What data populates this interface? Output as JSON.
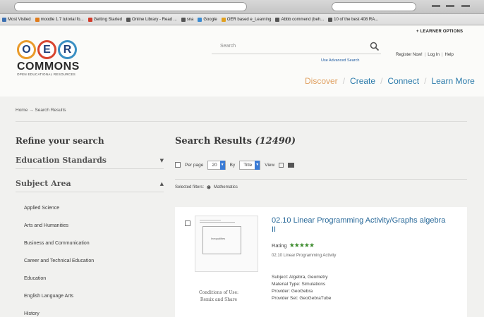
{
  "bookmarks": [
    {
      "label": "Most Visited",
      "color": "#3b6fb0"
    },
    {
      "label": "moodle 1.7 tutorial fo...",
      "color": "#e07b1a"
    },
    {
      "label": "Getting Started",
      "color": "#d13b2a"
    },
    {
      "label": "Online Library - Read ...",
      "color": "#555555"
    },
    {
      "label": "sna",
      "color": "#555555"
    },
    {
      "label": "Google",
      "color": "#3a8ad0"
    },
    {
      "label": "OER based e_Learning",
      "color": "#e0a020"
    },
    {
      "label": "Abbb commend (beh...",
      "color": "#555555"
    },
    {
      "label": "10 of the best 408 RA...",
      "color": "#555555"
    }
  ],
  "logo": {
    "letters": [
      "O",
      "E",
      "R"
    ],
    "name": "COMMONS",
    "tagline": "OPEN EDUCATIONAL RESOURCES"
  },
  "header": {
    "search_placeholder": "Search",
    "advanced_search": "Use Advanced Search",
    "learner_options": "+ LEARNER OPTIONS",
    "register": "Register Now!",
    "login": "Log In",
    "help": "Help",
    "nav": [
      "Discover",
      "Create",
      "Connect",
      "Learn More"
    ]
  },
  "breadcrumb": "Home → Search Results",
  "sidebar": {
    "title": "Refine your search",
    "facets": [
      {
        "label": "Education Standards",
        "arrow": "▼"
      },
      {
        "label": "Subject Area",
        "arrow": "▲"
      }
    ],
    "subjects": [
      "Applied Science",
      "Arts and Humanities",
      "Business and Communication",
      "Career and Technical Education",
      "Education",
      "English Language Arts",
      "History"
    ]
  },
  "results": {
    "title": "Search Results",
    "count": "(12490)",
    "per_page_label": "Per page",
    "per_page_value": "20",
    "by_label": "By",
    "by_value": "Title",
    "view_label": "View",
    "selected_filters_label": "Selected filters:",
    "filter": "Mathematics",
    "item": {
      "title": "02.10 Linear Programming Activity/Graphs algebra II",
      "rating_label": "Rating",
      "stars": "★★★★★",
      "description": "02.10 Linear Programming Activity",
      "thumb_label": "Inequalities",
      "conditions_label": "Conditions of Use:",
      "conditions_value": "Remix and Share",
      "subject": "Subject: Algebra, Geometry",
      "material_type": "Material Type: Simulations",
      "provider": "Provider: GeoGebra",
      "provider_set": "Provider Set: GeoGebraTube"
    }
  },
  "colors": {
    "link": "#2a6a9a",
    "discover": "#e0a060",
    "stars": "#3a8a2a"
  }
}
